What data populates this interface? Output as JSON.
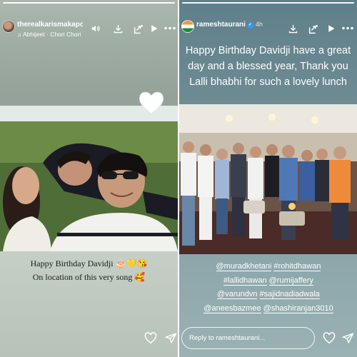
{
  "left_story": {
    "username": "therealkarismakapoo",
    "music": {
      "artist": "Abhijeet",
      "separator": "·",
      "song": "Chori Chori"
    },
    "caption_line1": "Happy Birthday Davidji",
    "caption_emojis1": "🎂💛😘",
    "caption_line2": "On location of this very song",
    "caption_emojis2": "🥰",
    "icons": [
      "volume-icon",
      "download-icon",
      "share-story-icon",
      "play-icon",
      "more-icon",
      "like-icon",
      "send-icon"
    ]
  },
  "right_story": {
    "username": "rameshtaurani",
    "timeago": "4h",
    "caption": "Happy Birthday Davidji have a great day and a blessed year, Thank you Lalli bhabhi for such a lovely lunch",
    "tags": {
      "line1": [
        "@muradkhetani",
        "#rohitdhawan"
      ],
      "line2": [
        "#lallidhawan",
        "@rumijaffery"
      ],
      "line3": [
        "@varundvn",
        "#sajidnadiadwala"
      ],
      "line4": [
        "@aneesbazmee",
        "@shashiranjan3010"
      ]
    },
    "reply_placeholder": "Reply to rameshtaurani...",
    "icons": [
      "download-icon",
      "share-story-icon",
      "play-icon",
      "more-icon",
      "like-icon",
      "send-icon"
    ]
  },
  "colors": {
    "text": "#ffffff",
    "caption_dark": "#1c1c1c",
    "verified_blue": "#3897f0"
  }
}
